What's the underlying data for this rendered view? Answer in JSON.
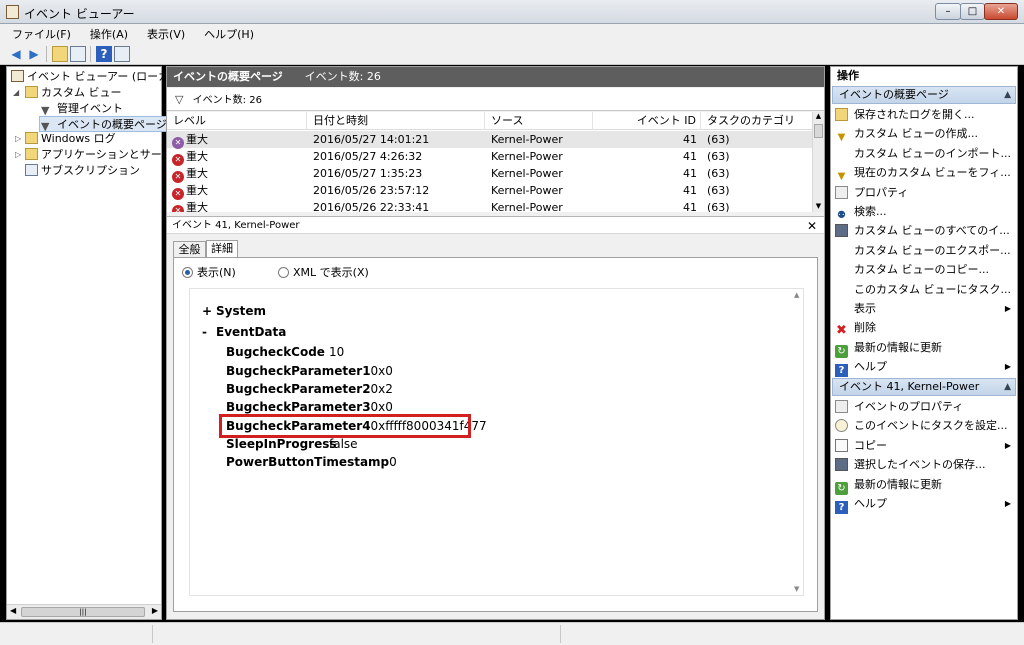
{
  "window": {
    "title": "イベント ビューアー"
  },
  "menu": [
    "ファイル(F)",
    "操作(A)",
    "表示(V)",
    "ヘルプ(H)"
  ],
  "tree": {
    "root": "イベント ビューアー (ローカル",
    "custom_views": "カスタム ビュー",
    "admin_events": "管理イベント",
    "overview_page": "イベントの概要ページ",
    "windows_logs": "Windows ログ",
    "apps_services": "アプリケーションとサービ",
    "subscriptions": "サブスクリプション"
  },
  "center": {
    "header_title": "イベントの概要ページ",
    "header_count": "イベント数: 26",
    "filter_text": "イベント数: 26",
    "columns": [
      "レベル",
      "日付と時刻",
      "ソース",
      "イベント ID",
      "タスクのカテゴリ"
    ],
    "rows": [
      {
        "level": "重大",
        "datetime": "2016/05/27 14:01:21",
        "source": "Kernel-Power",
        "id": "41",
        "category": "(63)"
      },
      {
        "level": "重大",
        "datetime": "2016/05/27 4:26:32",
        "source": "Kernel-Power",
        "id": "41",
        "category": "(63)"
      },
      {
        "level": "重大",
        "datetime": "2016/05/27 1:35:23",
        "source": "Kernel-Power",
        "id": "41",
        "category": "(63)"
      },
      {
        "level": "重大",
        "datetime": "2016/05/26 23:57:12",
        "source": "Kernel-Power",
        "id": "41",
        "category": "(63)"
      },
      {
        "level": "重大",
        "datetime": "2016/05/26 22:33:41",
        "source": "Kernel-Power",
        "id": "41",
        "category": "(63)"
      }
    ]
  },
  "detail": {
    "title": "イベント 41, Kernel-Power",
    "tab_general": "全般",
    "tab_details": "詳細",
    "radio_friendly": "表示(N)",
    "radio_xml": "XML で表示(X)",
    "system_label": "System",
    "eventdata_label": "EventData",
    "expand_plus": "+",
    "expand_minus": "-",
    "fields": [
      {
        "key": "BugcheckCode",
        "value": "10"
      },
      {
        "key": "BugcheckParameter1",
        "value": "0x0"
      },
      {
        "key": "BugcheckParameter2",
        "value": "0x2"
      },
      {
        "key": "BugcheckParameter3",
        "value": "0x0"
      },
      {
        "key": "BugcheckParameter4",
        "value": "0xfffff8000341f477"
      },
      {
        "key": "SleepInProgress",
        "value": "false"
      },
      {
        "key": "PowerButtonTimestamp",
        "value": "0"
      }
    ]
  },
  "actions": {
    "title": "操作",
    "section1": "イベントの概要ページ",
    "items1": [
      {
        "label": "保存されたログを開く...",
        "icon": "folder-open-icon"
      },
      {
        "label": "カスタム ビューの作成...",
        "icon": "filter-icon"
      },
      {
        "label": "カスタム ビューのインポート...",
        "icon": "none"
      },
      {
        "label": "現在のカスタム ビューをフィ...",
        "icon": "filter-icon"
      },
      {
        "label": "プロパティ",
        "icon": "properties-icon"
      },
      {
        "label": "検索...",
        "icon": "find-icon"
      },
      {
        "label": "カスタム ビューのすべてのイ...",
        "icon": "save-icon"
      },
      {
        "label": "カスタム ビューのエクスポー...",
        "icon": "none"
      },
      {
        "label": "カスタム ビューのコピー...",
        "icon": "none"
      },
      {
        "label": "このカスタム ビューにタスク...",
        "icon": "none"
      },
      {
        "label": "表示",
        "icon": "none",
        "submenu": true
      },
      {
        "label": "削除",
        "icon": "delete-icon"
      },
      {
        "label": "最新の情報に更新",
        "icon": "refresh-icon"
      },
      {
        "label": "ヘルプ",
        "icon": "help-icon",
        "submenu": true
      }
    ],
    "section2": "イベント 41, Kernel-Power",
    "items2": [
      {
        "label": "イベントのプロパティ",
        "icon": "properties-icon"
      },
      {
        "label": "このイベントにタスクを設定...",
        "icon": "task-icon"
      },
      {
        "label": "コピー",
        "icon": "copy-icon",
        "submenu": true
      },
      {
        "label": "選択したイベントの保存...",
        "icon": "save-icon"
      },
      {
        "label": "最新の情報に更新",
        "icon": "refresh-icon"
      },
      {
        "label": "ヘルプ",
        "icon": "help-icon",
        "submenu": true
      }
    ]
  },
  "colors": {
    "header_bg": "#5e5e5e",
    "section_bg": "#c3d5ea",
    "highlight_border": "#d21f1f",
    "error_red": "#c8252a"
  }
}
